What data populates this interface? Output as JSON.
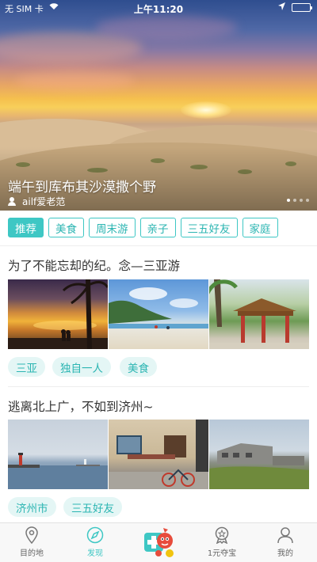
{
  "status_bar": {
    "carrier": "无 SIM 卡",
    "time": "上午11:20",
    "battery_level": 1.0
  },
  "hero": {
    "title": "端午到库布其沙漠撒个野",
    "author": "ailf爱老范",
    "page_count": 4,
    "active_page": 1
  },
  "tabs": [
    {
      "label": "推荐",
      "active": true
    },
    {
      "label": "美食",
      "active": false
    },
    {
      "label": "周末游",
      "active": false
    },
    {
      "label": "亲子",
      "active": false
    },
    {
      "label": "三五好友",
      "active": false
    },
    {
      "label": "家庭",
      "active": false
    }
  ],
  "posts": [
    {
      "title": "为了不能忘却的纪。念—三亚游",
      "tags": [
        "三亚",
        "独自一人",
        "美食"
      ]
    },
    {
      "title": "逃离北上广，不如到济州~",
      "tags": [
        "济州市",
        "三五好友"
      ]
    }
  ],
  "bottom_nav": [
    {
      "label": "目的地",
      "icon": "location-pin-icon",
      "active": false
    },
    {
      "label": "发现",
      "icon": "compass-icon",
      "active": true
    },
    {
      "label": "",
      "icon": "mascot-icon",
      "active": false
    },
    {
      "label": "1元夺宝",
      "icon": "medal-icon",
      "active": false
    },
    {
      "label": "我的",
      "icon": "person-icon",
      "active": false
    }
  ],
  "colors": {
    "accent": "#3ec7c4",
    "accent_text": "#2bb5b2",
    "chip_bg": "#e4f6f5",
    "battery": "#4cd964"
  }
}
